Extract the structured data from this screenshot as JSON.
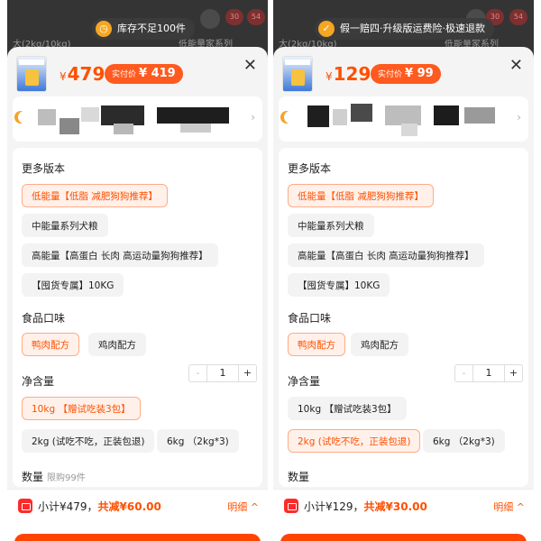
{
  "background": {
    "left_text": "大(2kg/10kg)",
    "right_text": "低能量家系列",
    "badge_left": "30",
    "badge_right": "54"
  },
  "left": {
    "toast": "库存不足100件",
    "toast_icon": "clock-icon",
    "price_currency": "¥",
    "price": "479",
    "pay_label": "实付价",
    "pay_price": "¥ 419",
    "footer_subtotal": "小计¥479，",
    "footer_saving": "共减¥60.00",
    "selected_weight_index": 0
  },
  "right": {
    "toast": "假一赔四·升级版运费险·极速退款",
    "toast_icon": "check-shield-icon",
    "price_currency": "¥",
    "price": "129",
    "pay_label": "实付价",
    "pay_price": "¥ 99",
    "footer_subtotal": "小计¥129，",
    "footer_saving": "共减¥30.00",
    "selected_weight_index": 1
  },
  "common": {
    "close": "✕",
    "section_versions": "更多版本",
    "versions": [
      "低能量【低脂 减肥狗狗推荐】",
      "中能量系列犬粮",
      "高能量【高蛋白 长肉 高运动量狗狗推荐】",
      "【囤货专属】10KG"
    ],
    "section_flavor": "食品口味",
    "flavors": [
      "鸭肉配方",
      "鸡肉配方"
    ],
    "section_weight": "净含量",
    "weights": [
      "10kg 【赠试吃装3包】",
      "2kg (试吃不吃，正装包退)",
      "6kg （2kg*3)"
    ],
    "section_qty": "数量",
    "qty_limit": "限购99件",
    "qty_minus": "-",
    "qty_value": "1",
    "qty_plus": "+",
    "footer_detail": "明细 ^",
    "shop_arrow": "›",
    "accent_color": "#ff5000"
  }
}
